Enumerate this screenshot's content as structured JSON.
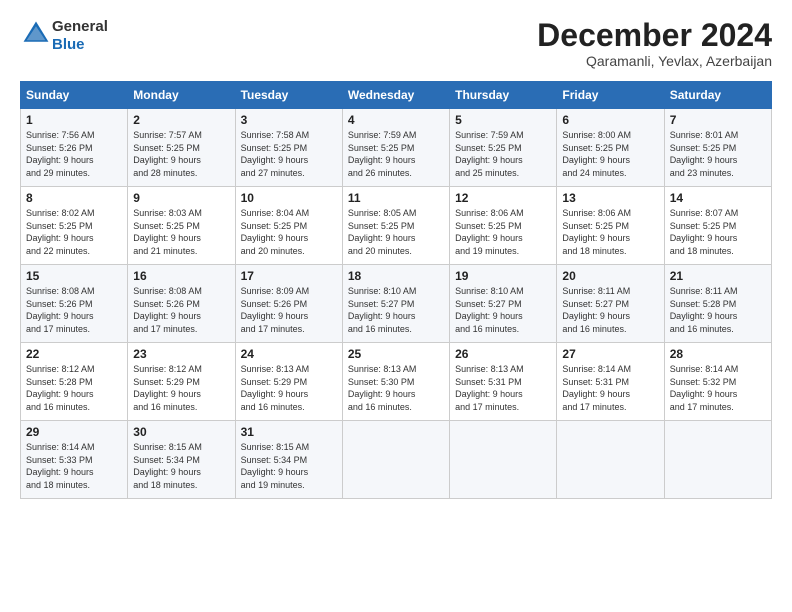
{
  "header": {
    "logo_general": "General",
    "logo_blue": "Blue",
    "month_title": "December 2024",
    "location": "Qaramanli, Yevlax, Azerbaijan"
  },
  "columns": [
    "Sunday",
    "Monday",
    "Tuesday",
    "Wednesday",
    "Thursday",
    "Friday",
    "Saturday"
  ],
  "weeks": [
    [
      {
        "day": "1",
        "lines": [
          "Sunrise: 7:56 AM",
          "Sunset: 5:26 PM",
          "Daylight: 9 hours",
          "and 29 minutes."
        ]
      },
      {
        "day": "2",
        "lines": [
          "Sunrise: 7:57 AM",
          "Sunset: 5:25 PM",
          "Daylight: 9 hours",
          "and 28 minutes."
        ]
      },
      {
        "day": "3",
        "lines": [
          "Sunrise: 7:58 AM",
          "Sunset: 5:25 PM",
          "Daylight: 9 hours",
          "and 27 minutes."
        ]
      },
      {
        "day": "4",
        "lines": [
          "Sunrise: 7:59 AM",
          "Sunset: 5:25 PM",
          "Daylight: 9 hours",
          "and 26 minutes."
        ]
      },
      {
        "day": "5",
        "lines": [
          "Sunrise: 7:59 AM",
          "Sunset: 5:25 PM",
          "Daylight: 9 hours",
          "and 25 minutes."
        ]
      },
      {
        "day": "6",
        "lines": [
          "Sunrise: 8:00 AM",
          "Sunset: 5:25 PM",
          "Daylight: 9 hours",
          "and 24 minutes."
        ]
      },
      {
        "day": "7",
        "lines": [
          "Sunrise: 8:01 AM",
          "Sunset: 5:25 PM",
          "Daylight: 9 hours",
          "and 23 minutes."
        ]
      }
    ],
    [
      {
        "day": "8",
        "lines": [
          "Sunrise: 8:02 AM",
          "Sunset: 5:25 PM",
          "Daylight: 9 hours",
          "and 22 minutes."
        ]
      },
      {
        "day": "9",
        "lines": [
          "Sunrise: 8:03 AM",
          "Sunset: 5:25 PM",
          "Daylight: 9 hours",
          "and 21 minutes."
        ]
      },
      {
        "day": "10",
        "lines": [
          "Sunrise: 8:04 AM",
          "Sunset: 5:25 PM",
          "Daylight: 9 hours",
          "and 20 minutes."
        ]
      },
      {
        "day": "11",
        "lines": [
          "Sunrise: 8:05 AM",
          "Sunset: 5:25 PM",
          "Daylight: 9 hours",
          "and 20 minutes."
        ]
      },
      {
        "day": "12",
        "lines": [
          "Sunrise: 8:06 AM",
          "Sunset: 5:25 PM",
          "Daylight: 9 hours",
          "and 19 minutes."
        ]
      },
      {
        "day": "13",
        "lines": [
          "Sunrise: 8:06 AM",
          "Sunset: 5:25 PM",
          "Daylight: 9 hours",
          "and 18 minutes."
        ]
      },
      {
        "day": "14",
        "lines": [
          "Sunrise: 8:07 AM",
          "Sunset: 5:25 PM",
          "Daylight: 9 hours",
          "and 18 minutes."
        ]
      }
    ],
    [
      {
        "day": "15",
        "lines": [
          "Sunrise: 8:08 AM",
          "Sunset: 5:26 PM",
          "Daylight: 9 hours",
          "and 17 minutes."
        ]
      },
      {
        "day": "16",
        "lines": [
          "Sunrise: 8:08 AM",
          "Sunset: 5:26 PM",
          "Daylight: 9 hours",
          "and 17 minutes."
        ]
      },
      {
        "day": "17",
        "lines": [
          "Sunrise: 8:09 AM",
          "Sunset: 5:26 PM",
          "Daylight: 9 hours",
          "and 17 minutes."
        ]
      },
      {
        "day": "18",
        "lines": [
          "Sunrise: 8:10 AM",
          "Sunset: 5:27 PM",
          "Daylight: 9 hours",
          "and 16 minutes."
        ]
      },
      {
        "day": "19",
        "lines": [
          "Sunrise: 8:10 AM",
          "Sunset: 5:27 PM",
          "Daylight: 9 hours",
          "and 16 minutes."
        ]
      },
      {
        "day": "20",
        "lines": [
          "Sunrise: 8:11 AM",
          "Sunset: 5:27 PM",
          "Daylight: 9 hours",
          "and 16 minutes."
        ]
      },
      {
        "day": "21",
        "lines": [
          "Sunrise: 8:11 AM",
          "Sunset: 5:28 PM",
          "Daylight: 9 hours",
          "and 16 minutes."
        ]
      }
    ],
    [
      {
        "day": "22",
        "lines": [
          "Sunrise: 8:12 AM",
          "Sunset: 5:28 PM",
          "Daylight: 9 hours",
          "and 16 minutes."
        ]
      },
      {
        "day": "23",
        "lines": [
          "Sunrise: 8:12 AM",
          "Sunset: 5:29 PM",
          "Daylight: 9 hours",
          "and 16 minutes."
        ]
      },
      {
        "day": "24",
        "lines": [
          "Sunrise: 8:13 AM",
          "Sunset: 5:29 PM",
          "Daylight: 9 hours",
          "and 16 minutes."
        ]
      },
      {
        "day": "25",
        "lines": [
          "Sunrise: 8:13 AM",
          "Sunset: 5:30 PM",
          "Daylight: 9 hours",
          "and 16 minutes."
        ]
      },
      {
        "day": "26",
        "lines": [
          "Sunrise: 8:13 AM",
          "Sunset: 5:31 PM",
          "Daylight: 9 hours",
          "and 17 minutes."
        ]
      },
      {
        "day": "27",
        "lines": [
          "Sunrise: 8:14 AM",
          "Sunset: 5:31 PM",
          "Daylight: 9 hours",
          "and 17 minutes."
        ]
      },
      {
        "day": "28",
        "lines": [
          "Sunrise: 8:14 AM",
          "Sunset: 5:32 PM",
          "Daylight: 9 hours",
          "and 17 minutes."
        ]
      }
    ],
    [
      {
        "day": "29",
        "lines": [
          "Sunrise: 8:14 AM",
          "Sunset: 5:33 PM",
          "Daylight: 9 hours",
          "and 18 minutes."
        ]
      },
      {
        "day": "30",
        "lines": [
          "Sunrise: 8:15 AM",
          "Sunset: 5:34 PM",
          "Daylight: 9 hours",
          "and 18 minutes."
        ]
      },
      {
        "day": "31",
        "lines": [
          "Sunrise: 8:15 AM",
          "Sunset: 5:34 PM",
          "Daylight: 9 hours",
          "and 19 minutes."
        ]
      },
      {
        "day": "",
        "lines": []
      },
      {
        "day": "",
        "lines": []
      },
      {
        "day": "",
        "lines": []
      },
      {
        "day": "",
        "lines": []
      }
    ]
  ]
}
